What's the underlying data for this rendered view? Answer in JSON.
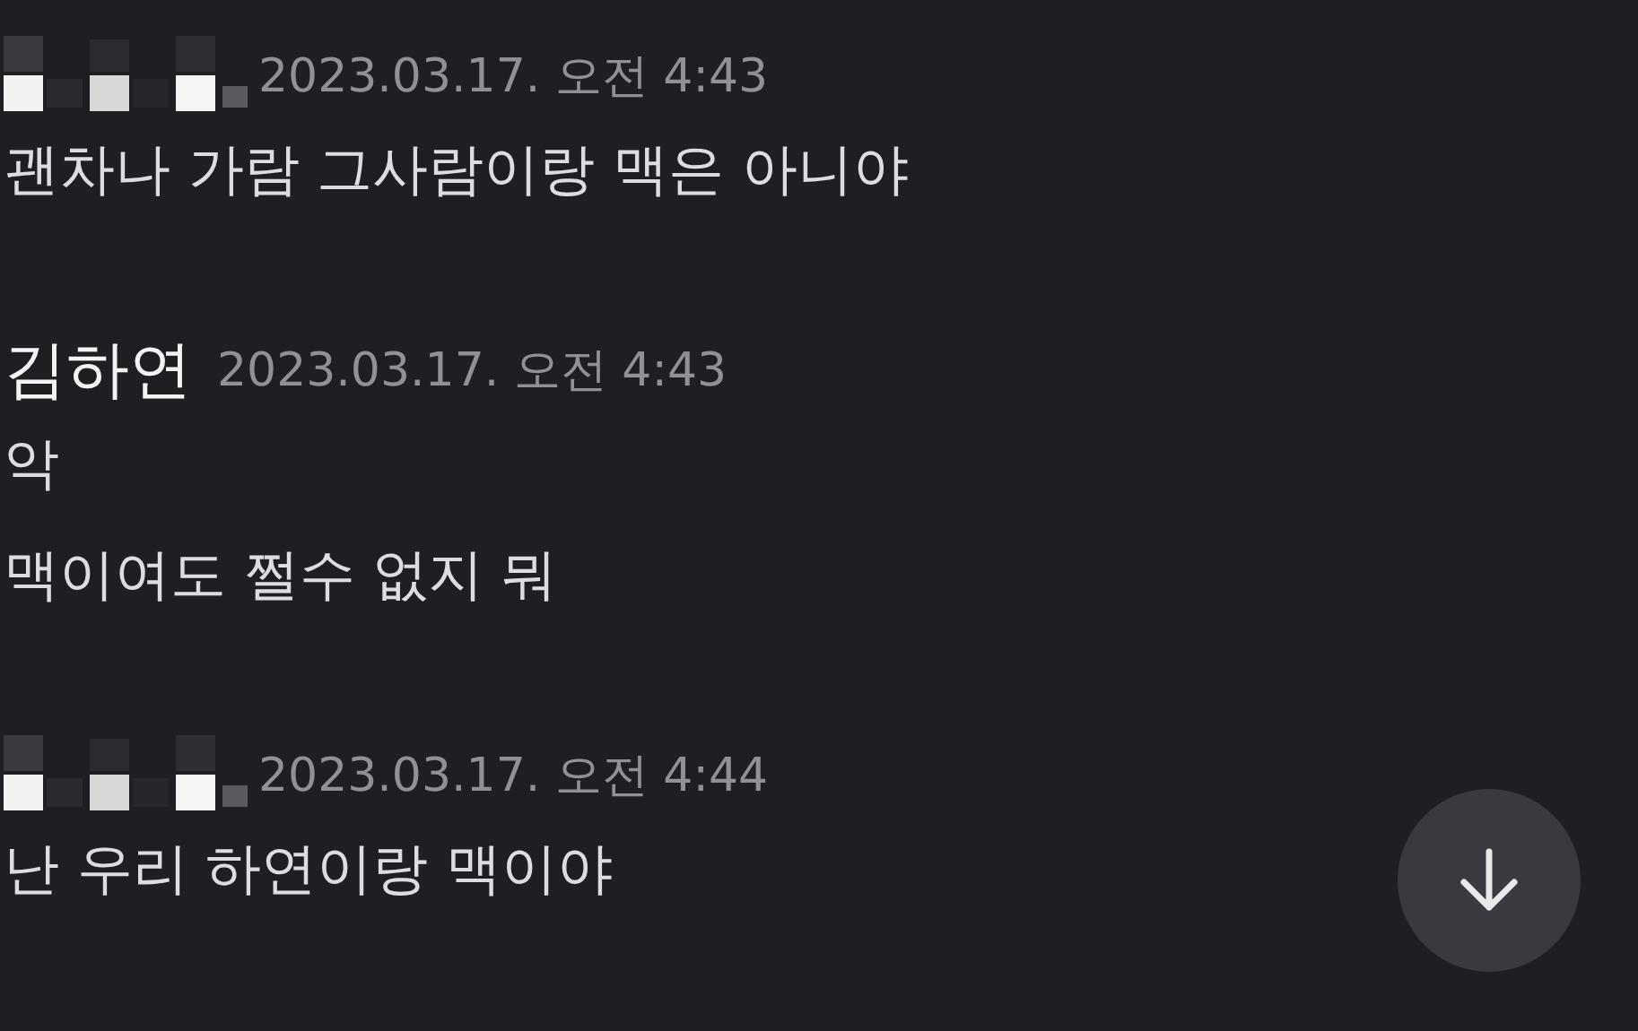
{
  "messages": [
    {
      "author": {
        "kind": "redacted"
      },
      "timestamp": "2023.03.17. 오전 4:43",
      "lines": [
        "괜차나 가람 그사람이랑 맥은 아니야"
      ]
    },
    {
      "author": {
        "kind": "name",
        "name": "김하연"
      },
      "timestamp": "2023.03.17. 오전 4:43",
      "lines": [
        "악",
        "맥이여도 쩔수 없지 뭐"
      ]
    },
    {
      "author": {
        "kind": "redacted"
      },
      "timestamp": "2023.03.17. 오전 4:44",
      "lines": [
        "난 우리 하연이랑 맥이야"
      ]
    }
  ]
}
